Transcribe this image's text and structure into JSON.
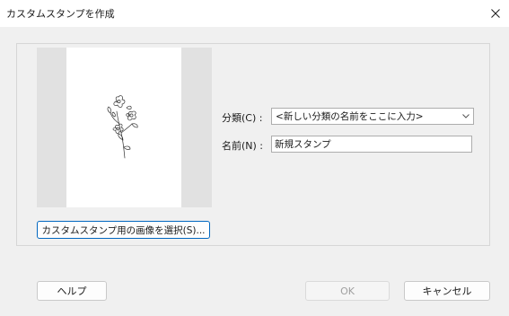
{
  "window": {
    "title": "カスタムスタンプを作成"
  },
  "icons": {
    "close": "close-icon",
    "dropdown": "chevron-down-icon",
    "preview": "flower-sketch"
  },
  "preview": {
    "select_image_label": "カスタムスタンプ用の画像を選択(S)..."
  },
  "form": {
    "category_label": "分類(C) :",
    "category_value": "<新しい分類の名前をここに入力>",
    "name_label": "名前(N) :",
    "name_value": "新規スタンプ"
  },
  "buttons": {
    "help": "ヘルプ",
    "ok": "OK",
    "cancel": "キャンセル"
  }
}
